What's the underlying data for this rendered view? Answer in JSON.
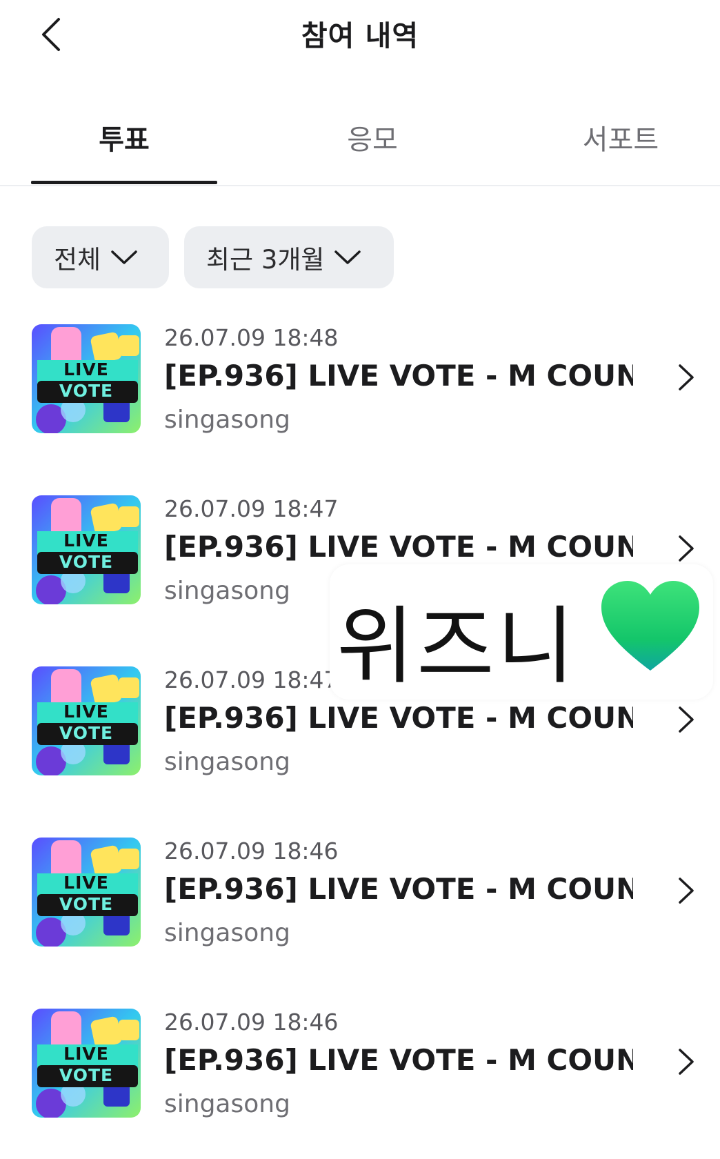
{
  "header": {
    "title": "참여 내역"
  },
  "tabs": [
    {
      "label": "투표",
      "active": true
    },
    {
      "label": "응모",
      "active": false
    },
    {
      "label": "서포트",
      "active": false
    }
  ],
  "filters": {
    "category": "전체",
    "period": "최근 3개월"
  },
  "items": [
    {
      "time": "26.07.09 18:48",
      "title": "[EP.936] LIVE VOTE - M COUN...",
      "sub": "singasong",
      "thumb_text": [
        "LIVE",
        "VOTE"
      ]
    },
    {
      "time": "26.07.09 18:47",
      "title": "[EP.936] LIVE VOTE - M COUN...",
      "sub": "singasong",
      "thumb_text": [
        "LIVE",
        "VOTE"
      ]
    },
    {
      "time": "26.07.09 18:47",
      "title": "[EP.936] LIVE VOTE - M COUN...",
      "sub": "singasong",
      "thumb_text": [
        "LIVE",
        "VOTE"
      ]
    },
    {
      "time": "26.07.09 18:46",
      "title": "[EP.936] LIVE VOTE - M COUN...",
      "sub": "singasong",
      "thumb_text": [
        "LIVE",
        "VOTE"
      ]
    },
    {
      "time": "26.07.09 18:46",
      "title": "[EP.936] LIVE VOTE - M COUN...",
      "sub": "singasong",
      "thumb_text": [
        "LIVE",
        "VOTE"
      ]
    }
  ],
  "sticker": {
    "text": "위즈니",
    "emoji": "green-heart-icon"
  },
  "icons": {
    "back": "chevron-left-icon",
    "dropdown": "chevron-down-icon",
    "row": "chevron-right-icon"
  }
}
